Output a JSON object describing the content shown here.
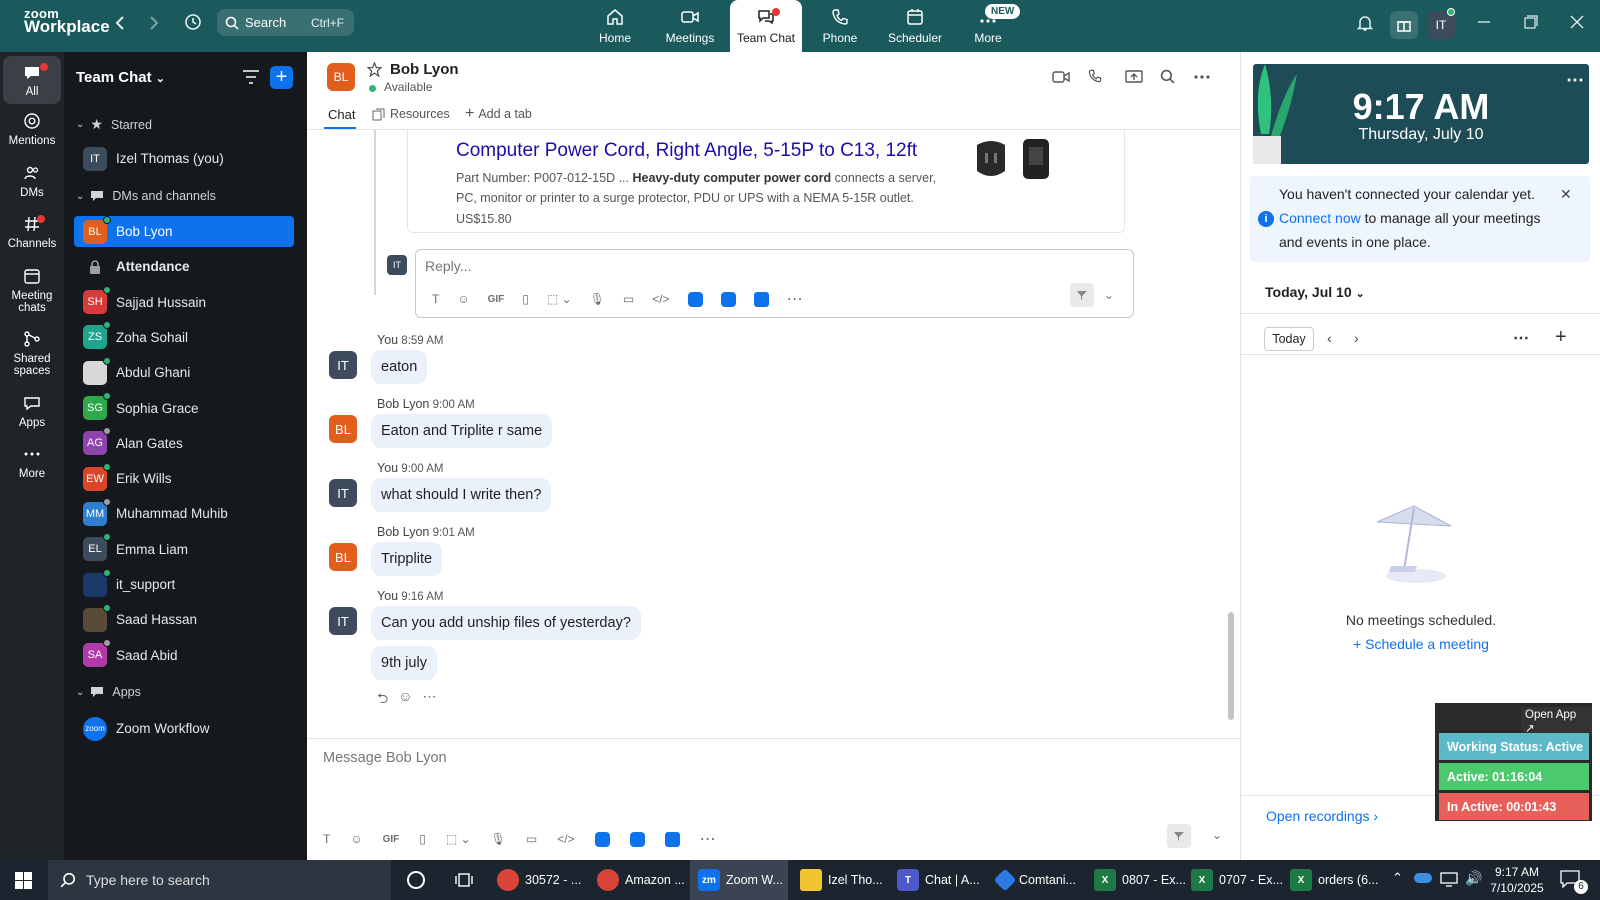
{
  "app": {
    "brand_line1": "zoom",
    "brand_line2": "Workplace"
  },
  "topbar": {
    "search_placeholder": "Search",
    "search_shortcut": "Ctrl+F",
    "tabs": [
      {
        "label": "Home",
        "icon": "home-icon"
      },
      {
        "label": "Meetings",
        "icon": "video-camera-icon"
      },
      {
        "label": "Team Chat",
        "icon": "chat-bubbles-icon"
      },
      {
        "label": "Phone",
        "icon": "phone-icon"
      },
      {
        "label": "Scheduler",
        "icon": "calendar-icon"
      },
      {
        "label": "More",
        "icon": "more-dots-icon"
      }
    ],
    "new_badge": "NEW",
    "avatar_initials": "IT"
  },
  "rail": {
    "items": [
      {
        "label": "All",
        "icon": "chat-icon"
      },
      {
        "label": "Mentions",
        "icon": "at-icon"
      },
      {
        "label": "DMs",
        "icon": "people-icon"
      },
      {
        "label": "Channels",
        "icon": "hash-icon"
      },
      {
        "label": "Meeting chats",
        "icon": "calendar-icon"
      },
      {
        "label": "Shared spaces",
        "icon": "share-icon"
      },
      {
        "label": "Apps",
        "icon": "apps-icon"
      },
      {
        "label": "More",
        "icon": "more-icon"
      }
    ]
  },
  "sidebar": {
    "title": "Team Chat",
    "starred_label": "Starred",
    "starred": [
      {
        "name": "Izel Thomas (you)",
        "initials": "IT",
        "color": "#3d4c5c"
      }
    ],
    "dms_label": "DMs and channels",
    "items": [
      {
        "name": "Bob Lyon",
        "initials": "BL",
        "color": "#e35d1c",
        "status": "#2bb673"
      },
      {
        "name": "Attendance",
        "initials": "",
        "color": "#3a3f44",
        "status": ""
      },
      {
        "name": "Sajjad Hussain",
        "initials": "SH",
        "color": "#d93b3b",
        "status": "#2bb673"
      },
      {
        "name": "Zoha Sohail",
        "initials": "ZS",
        "color": "#1fa58b",
        "status": "#2bb673"
      },
      {
        "name": "Abdul Ghani",
        "initials": "",
        "color": "#d8d8d8",
        "status": "#2bb673"
      },
      {
        "name": "Sophia Grace",
        "initials": "SG",
        "color": "#2ea84a",
        "status": "#2bb673"
      },
      {
        "name": "Alan Gates",
        "initials": "AG",
        "color": "#8e44ad",
        "status": "#9aa0a6"
      },
      {
        "name": "Erik Wills",
        "initials": "EW",
        "color": "#d9472b",
        "status": "#2bb673"
      },
      {
        "name": "Muhammad Muhib",
        "initials": "MM",
        "color": "#2f7fd0",
        "status": "#9aa0a6"
      },
      {
        "name": "Emma Liam",
        "initials": "EL",
        "color": "#3d4c5c",
        "status": "#2bb673"
      },
      {
        "name": "it_support",
        "initials": "",
        "color": "#1b3a6b",
        "status": "#2bb673"
      },
      {
        "name": "Saad Hassan",
        "initials": "",
        "color": "#5a4a3a",
        "status": "#2bb673"
      },
      {
        "name": "Saad Abid",
        "initials": "SA",
        "color": "#b03aa8",
        "status": "#9aa0a6"
      }
    ],
    "apps_label": "Apps",
    "apps": [
      {
        "name": "Zoom Workflow",
        "initials": "zoom",
        "color": "#0e72ed"
      }
    ]
  },
  "chat": {
    "contact_name": "Bob Lyon",
    "contact_initials": "BL",
    "presence": "Available",
    "tabs": [
      {
        "label": "Chat"
      },
      {
        "label": "Resources"
      },
      {
        "label": "Add a tab"
      }
    ],
    "link_preview": {
      "title": "Computer Power Cord, Right Angle, 5-15P to C13, 12ft",
      "part_prefix": "Part Number: P007-012-15D ... ",
      "part_bold1": "Heavy-duty computer power cord",
      "part_rest": " connects a server, PC, monitor or printer to a surge protector, PDU or UPS with a NEMA 5-15R outlet.",
      "price": "US$15.80"
    },
    "reply_placeholder": "Reply...",
    "messages": [
      {
        "sender": "You",
        "time": "8:59 AM",
        "initials": "IT",
        "color": "#3d4c5c",
        "texts": [
          "eaton"
        ]
      },
      {
        "sender": "Bob Lyon",
        "time": "9:00 AM",
        "initials": "BL",
        "color": "#e35d1c",
        "texts": [
          "Eaton and Triplite r same"
        ]
      },
      {
        "sender": "You",
        "time": "9:00 AM",
        "initials": "IT",
        "color": "#3d4c5c",
        "texts": [
          "what should I write then?"
        ]
      },
      {
        "sender": "Bob Lyon",
        "time": "9:01 AM",
        "initials": "BL",
        "color": "#e35d1c",
        "texts": [
          "Tripplite"
        ]
      },
      {
        "sender": "You",
        "time": "9:16 AM",
        "initials": "IT",
        "color": "#3d4c5c",
        "texts": [
          "Can you add unship files of yesterday?",
          "9th july"
        ]
      }
    ],
    "composer_placeholder": "Message Bob Lyon",
    "gif_label": "GIF"
  },
  "right": {
    "time": "9:17 AM",
    "date": "Thursday, July 10",
    "notice_pre": "You haven't connected your calendar yet. ",
    "notice_link": "Connect now",
    "notice_post": " to manage all your meetings and events in one place.",
    "day_label": "Today, Jul 10",
    "today_btn": "Today",
    "empty_text": "No meetings scheduled.",
    "schedule_link": "Schedule a meeting",
    "open_recordings": "Open recordings"
  },
  "status_widget": {
    "open_app": "Open App ↗",
    "working": "Working Status: Active",
    "active": "Active: 01:16:04",
    "inactive": "In Active: 00:01:43"
  },
  "taskbar": {
    "search_placeholder": "Type here to search",
    "apps": [
      {
        "label": "30572 - ...",
        "color": "#db4437"
      },
      {
        "label": "Amazon ...",
        "color": "#db4437"
      },
      {
        "label": "Zoom W...",
        "color": "#0e72ed"
      },
      {
        "label": "Izel Tho...",
        "color": "#f4c430"
      },
      {
        "label": "Chat | A...",
        "color": "#5059c9"
      },
      {
        "label": "Comtani...",
        "color": "#2c7be5"
      },
      {
        "label": "0807 - Ex...",
        "color": "#1d7a45"
      },
      {
        "label": "0707 - Ex...",
        "color": "#1d7a45"
      },
      {
        "label": "orders (6...",
        "color": "#1d7a45"
      }
    ],
    "time": "9:17 AM",
    "date": "7/10/2025",
    "notif_count": "6"
  }
}
